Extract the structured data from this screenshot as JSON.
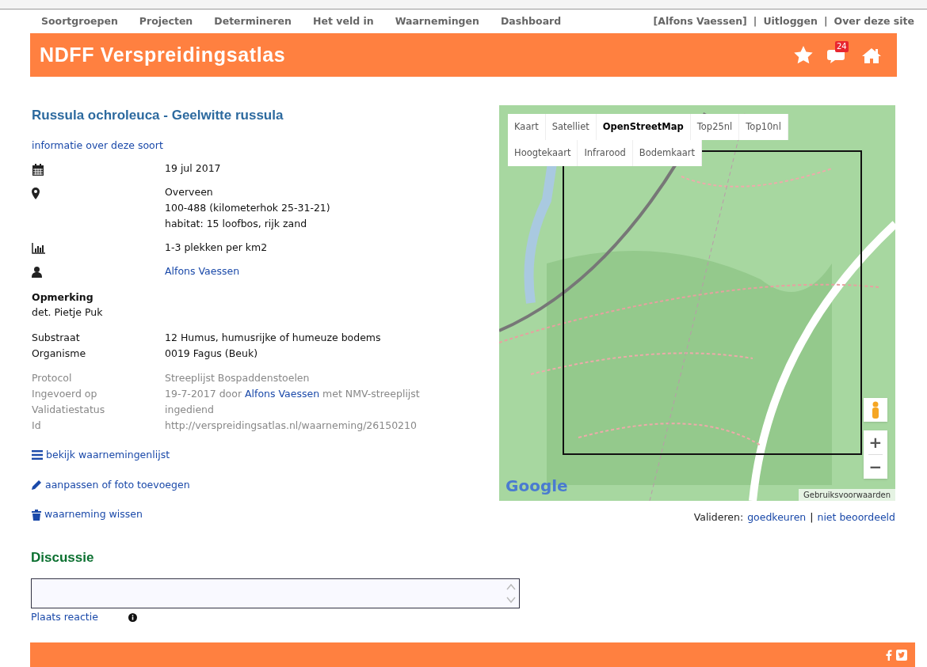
{
  "nav": {
    "items": [
      "Soortgroepen",
      "Projecten",
      "Determineren",
      "Het veld in",
      "Waarnemingen",
      "Dashboard"
    ],
    "user": "[Alfons Vaessen]",
    "links": [
      "Uitloggen",
      "Over deze site"
    ],
    "separators": [
      "|",
      "|"
    ]
  },
  "header": {
    "title": "NDFF Verspreidingsatlas",
    "badge": "24"
  },
  "species": {
    "title": "Russula ochroleuca - Geelwitte russula",
    "info_link": "informatie over deze soort"
  },
  "facts": [
    {
      "kind": "date",
      "lines": [
        "19 jul 2017"
      ]
    },
    {
      "kind": "location",
      "lines": [
        "Overveen",
        "100-488 (kilometerhok 25-31-21)",
        "habitat: 15 loofbos, rijk zand"
      ]
    },
    {
      "kind": "count",
      "lines": [
        "1-3 plekken per km2"
      ]
    },
    {
      "kind": "observer",
      "link": "Alfons Vaessen"
    }
  ],
  "remark": {
    "label": "Opmerking",
    "text": "det. Pietje Puk"
  },
  "details": [
    {
      "label": "Substraat",
      "value": "12 Humus, humusrijke of humeuze bodems"
    },
    {
      "label": "Organisme",
      "value": "0019 Fagus (Beuk)"
    }
  ],
  "meta": [
    {
      "label": "Protocol",
      "value": "Streeplijst Bospaddenstoelen"
    },
    {
      "label": "Ingevoerd op",
      "before": "19-7-2017 door",
      "link": "Alfons Vaessen",
      "after": "met NMV-streeplijst"
    },
    {
      "label": "Validatiestatus",
      "value": "ingediend"
    },
    {
      "label": "Id",
      "value": "http://verspreidingsatlas.nl/waarneming/26150210"
    }
  ],
  "actions": [
    {
      "kind": "list",
      "label": "bekijk waarnemingenlijst"
    },
    {
      "kind": "edit",
      "label": "aanpassen of foto toevoegen"
    },
    {
      "kind": "delete",
      "label": "waarneming wissen"
    }
  ],
  "map": {
    "tabs": [
      {
        "label": "Kaart",
        "selected": false
      },
      {
        "label": "Satelliet",
        "selected": false
      },
      {
        "label": "OpenStreetMap",
        "selected": true
      },
      {
        "label": "Top25nl",
        "selected": false
      },
      {
        "label": "Top10nl",
        "selected": false
      },
      {
        "label": "Hoogtekaart",
        "selected": false
      },
      {
        "label": "Infrarood",
        "selected": false
      },
      {
        "label": "Bodemkaart",
        "selected": false
      }
    ],
    "logo": "Google",
    "terms": "Gebruiksvoorwaarden",
    "zoom_in": "+",
    "zoom_out": "−"
  },
  "validate": {
    "label": "Valideren:",
    "links": [
      "goedkeuren",
      "niet beoordeeld"
    ],
    "separators": [
      "|"
    ]
  },
  "discussion": {
    "title": "Discussie",
    "submit": "Plaats reactie"
  }
}
